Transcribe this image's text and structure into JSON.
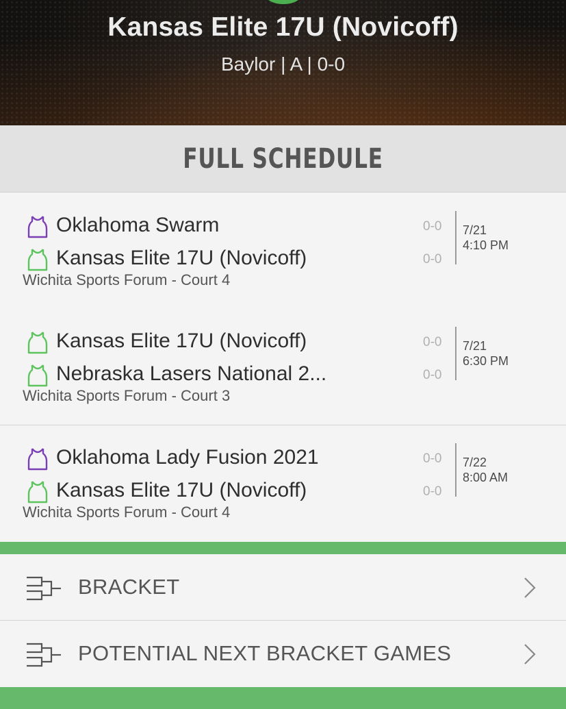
{
  "header": {
    "team_name": "Kansas Elite 17U (Novicoff)",
    "subtitle": "Baylor | A | 0-0"
  },
  "schedule": {
    "title": "FULL SCHEDULE",
    "games": [
      {
        "team1": {
          "name": "Oklahoma Swarm",
          "score": "0-0",
          "jersey_color": "#7b3fb5"
        },
        "team2": {
          "name": "Kansas Elite 17U (Novicoff)",
          "score": "0-0",
          "jersey_color": "#5cc35f"
        },
        "date": "7/21",
        "time": "4:10 PM",
        "venue": "Wichita Sports Forum - Court 4"
      },
      {
        "team1": {
          "name": "Kansas Elite 17U (Novicoff)",
          "score": "0-0",
          "jersey_color": "#5cc35f"
        },
        "team2": {
          "name": "Nebraska Lasers National 2...",
          "score": "0-0",
          "jersey_color": "#5cc35f"
        },
        "date": "7/21",
        "time": "6:30 PM",
        "venue": "Wichita Sports Forum - Court 3"
      },
      {
        "team1": {
          "name": "Oklahoma Lady Fusion 2021",
          "score": "0-0",
          "jersey_color": "#7b3fb5"
        },
        "team2": {
          "name": "Kansas Elite 17U (Novicoff)",
          "score": "0-0",
          "jersey_color": "#5cc35f"
        },
        "date": "7/22",
        "time": "8:00 AM",
        "venue": "Wichita Sports Forum - Court 4"
      }
    ]
  },
  "nav": {
    "bracket_label": "BRACKET",
    "potential_label": "POTENTIAL NEXT BRACKET GAMES"
  },
  "colors": {
    "accent_green": "#66b96a",
    "purple_jersey": "#7b3fb5",
    "green_jersey": "#5cc35f"
  },
  "icons": {
    "jersey": "jersey-icon",
    "bracket": "bracket-icon",
    "chevron": "chevron-right-icon"
  }
}
